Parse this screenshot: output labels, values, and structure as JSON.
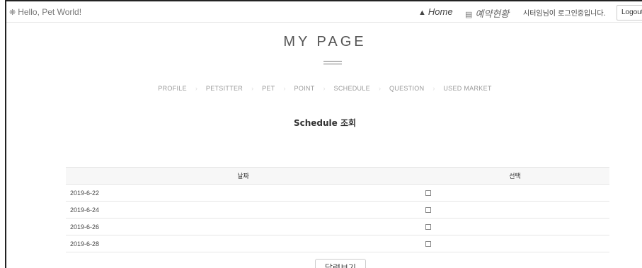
{
  "header": {
    "brand": "Hello, Pet World!",
    "brand_icon": "paw-icon",
    "nav_home": "Home",
    "nav_home_icon": "home-icon",
    "nav_reservation": "예약현황",
    "nav_reservation_icon": "clipboard-icon",
    "login_status": "시터임님이 로그인중입니다.",
    "logout_label": "Logout"
  },
  "page": {
    "title": "MY PAGE",
    "section_title": "Schedule 조회",
    "calendar_button": "달력보기"
  },
  "subnav": {
    "items": [
      "PROFILE",
      "PETSITTER",
      "PET",
      "POINT",
      "SCHEDULE",
      "QUESTION",
      "USED MARKET"
    ]
  },
  "table": {
    "headers": [
      "날짜",
      "선택"
    ],
    "rows": [
      {
        "date": "2019-6-22",
        "checked": false
      },
      {
        "date": "2019-6-24",
        "checked": false
      },
      {
        "date": "2019-6-26",
        "checked": false
      },
      {
        "date": "2019-6-28",
        "checked": false
      }
    ]
  }
}
